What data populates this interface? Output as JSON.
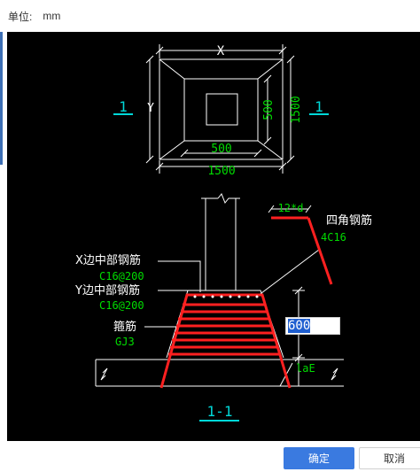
{
  "unit": {
    "label": "单位:",
    "value": "mm"
  },
  "drawing": {
    "plan": {
      "top_dim": "X",
      "side_dim": "Y",
      "inner_width": "500",
      "inner_height": "500",
      "outer_width": "1500",
      "outer_height": "1500",
      "section_mark_left": "1",
      "section_mark_right": "1"
    },
    "section": {
      "hook_length": "12*d",
      "corner_rebar_label": "四角钢筋",
      "corner_rebar_value": "4C16",
      "x_rebar_label": "X边中部钢筋",
      "x_rebar_value": "C16@200",
      "y_rebar_label": "Y边中部钢筋",
      "y_rebar_value": "C16@200",
      "stirrup_label": "箍筋",
      "stirrup_value": "GJ3",
      "anchorage_label": "laE",
      "section_title": "1-1"
    },
    "height_input": {
      "value": "600"
    }
  },
  "buttons": {
    "ok": "确定",
    "cancel": "取消"
  },
  "colors": {
    "line": "#ffffff",
    "dimension": "#00dd00",
    "rebar": "#ff2020",
    "section_mark": "#00d8d8",
    "accent": "#3a7ae0"
  }
}
